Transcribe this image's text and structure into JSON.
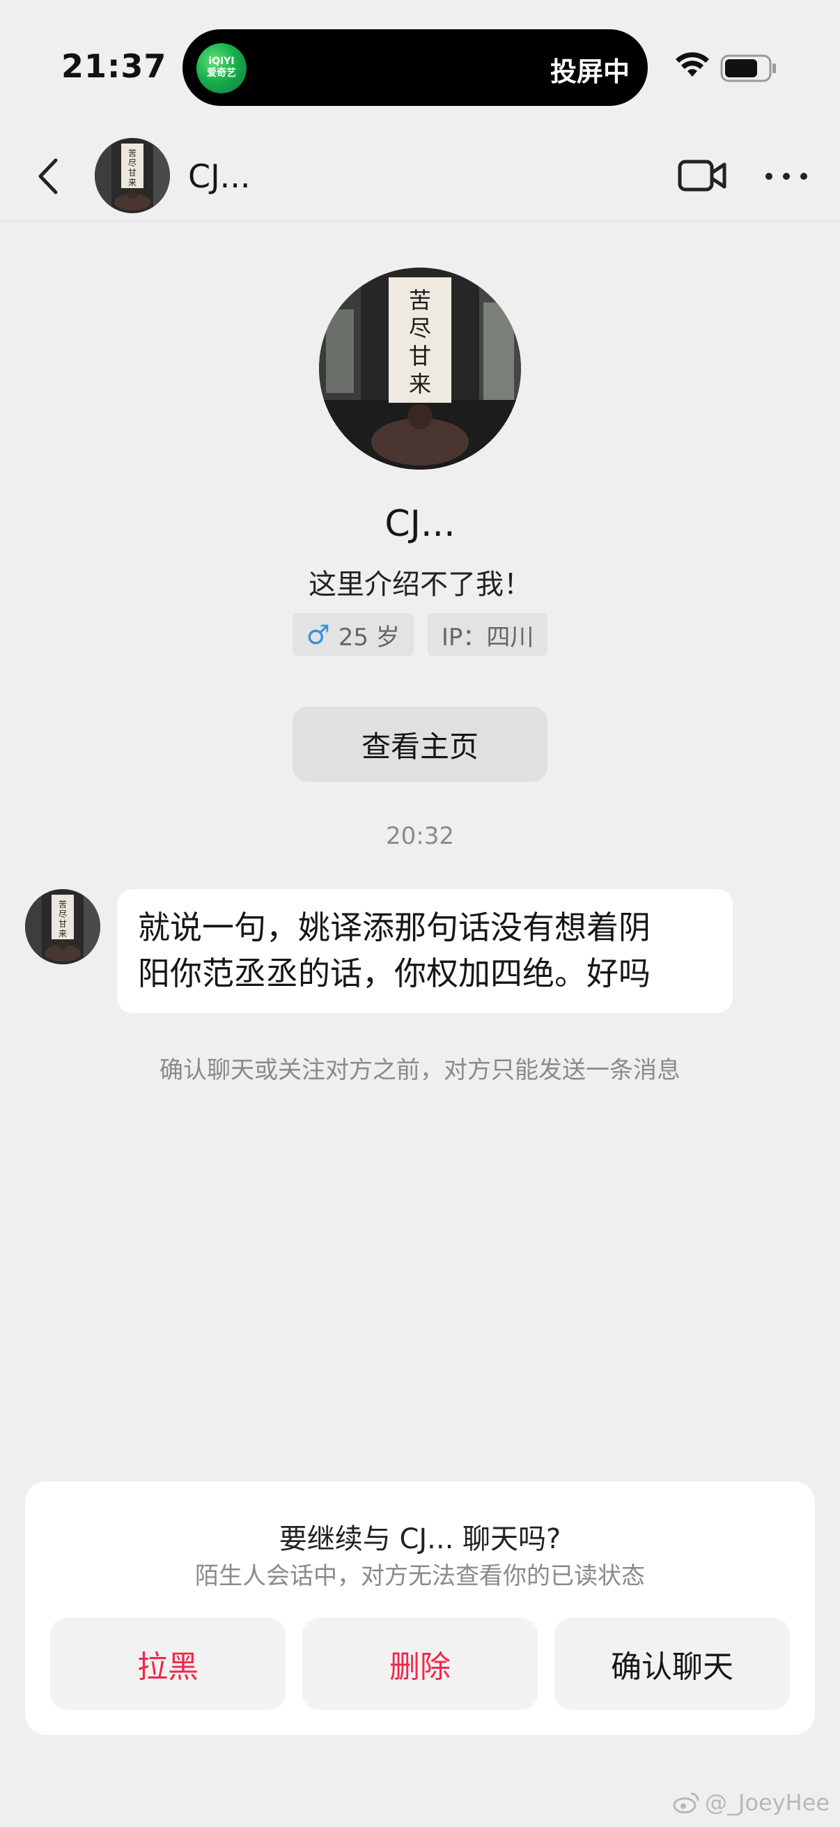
{
  "status": {
    "time": "21:37",
    "island_app": "爱奇艺",
    "island_app_brand": "iQIYI",
    "island_label": "投屏中"
  },
  "nav": {
    "name": "CJ..."
  },
  "profile": {
    "name": "CJ...",
    "bio": "这里介绍不了我！",
    "age_tag": "25 岁",
    "ip_tag": "IP：四川",
    "home_button": "查看主页"
  },
  "chat": {
    "timestamp": "20:32",
    "message_line1": "就说一句，姚译添那句话没有想着阴",
    "message_line2": "阳你范丞丞的话，你权加四绝。好吗",
    "notice": "确认聊天或关注对方之前，对方只能发送一条消息"
  },
  "prompt": {
    "title": "要继续与 CJ... 聊天吗?",
    "subtitle": "陌生人会话中，对方无法查看你的已读状态",
    "block_label": "拉黑",
    "delete_label": "删除",
    "confirm_label": "确认聊天"
  },
  "watermark": "@_JoeyHee",
  "colors": {
    "background": "#efefef",
    "danger": "#f0294a",
    "male_blue": "#3a8ee6"
  }
}
